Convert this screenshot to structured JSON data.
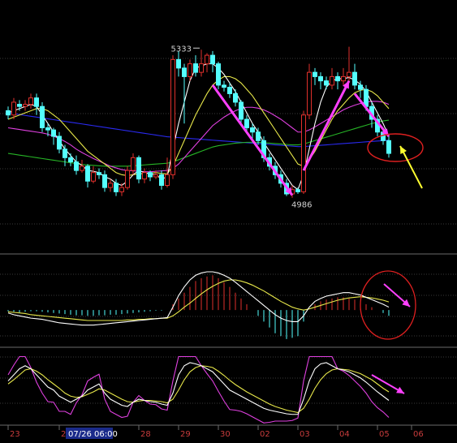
{
  "chart_data": {
    "type": "candlestick",
    "colors": {
      "background": "#000000",
      "up": "#e0302c",
      "down": "#54ffff",
      "ma_white": "#ffffff",
      "ma_yellow": "#e8e84a",
      "ma_magenta": "#e040e0",
      "ma_green": "#26b426",
      "ma_blue": "#2a2af0",
      "arrow_magenta": "#ff40ff",
      "arrow_yellow": "#ffff30",
      "circle": "#e02020",
      "grid": "#3a3a3a"
    },
    "price": {
      "ylim": [
        4860,
        5440
      ],
      "candles": [
        [
          5190,
          5180,
          5200,
          5170
        ],
        [
          5180,
          5210,
          5220,
          5170
        ],
        [
          5205,
          5200,
          5215,
          5190
        ],
        [
          5200,
          5205,
          5215,
          5190
        ],
        [
          5205,
          5220,
          5230,
          5195
        ],
        [
          5220,
          5200,
          5230,
          5180
        ],
        [
          5200,
          5150,
          5210,
          5140
        ],
        [
          5150,
          5145,
          5160,
          5130
        ],
        [
          5145,
          5130,
          5150,
          5110
        ],
        [
          5130,
          5100,
          5140,
          5090
        ],
        [
          5100,
          5080,
          5110,
          5060
        ],
        [
          5080,
          5070,
          5090,
          5060
        ],
        [
          5070,
          5050,
          5085,
          5040
        ],
        [
          5050,
          5060,
          5075,
          5045
        ],
        [
          5060,
          5025,
          5065,
          5010
        ],
        [
          5025,
          5045,
          5060,
          5020
        ],
        [
          5045,
          5040,
          5055,
          5030
        ],
        [
          5040,
          5010,
          5050,
          5000
        ],
        [
          5010,
          5020,
          5030,
          5000
        ],
        [
          5020,
          5000,
          5030,
          4990
        ],
        [
          5000,
          5010,
          5020,
          4990
        ],
        [
          5010,
          5050,
          5060,
          5005
        ],
        [
          5050,
          5080,
          5090,
          5040
        ],
        [
          5080,
          5030,
          5085,
          5020
        ],
        [
          5030,
          5045,
          5055,
          5020
        ],
        [
          5045,
          5035,
          5050,
          5025
        ],
        [
          5035,
          5040,
          5050,
          5030
        ],
        [
          5040,
          5015,
          5050,
          5005
        ],
        [
          5015,
          5040,
          5080,
          5010
        ],
        [
          5040,
          5310,
          5320,
          5030
        ],
        [
          5310,
          5290,
          5330,
          5270
        ],
        [
          5290,
          5270,
          5300,
          5160
        ],
        [
          5270,
          5300,
          5310,
          5260
        ],
        [
          5300,
          5280,
          5320,
          5270
        ],
        [
          5280,
          5300,
          5333,
          5270
        ],
        [
          5300,
          5320,
          5325,
          5280
        ],
        [
          5320,
          5300,
          5330,
          5280
        ],
        [
          5300,
          5250,
          5305,
          5240
        ],
        [
          5250,
          5245,
          5260,
          5235
        ],
        [
          5245,
          5230,
          5255,
          5220
        ],
        [
          5230,
          5210,
          5240,
          5200
        ],
        [
          5210,
          5170,
          5215,
          5160
        ],
        [
          5170,
          5150,
          5180,
          5140
        ],
        [
          5150,
          5140,
          5160,
          5125
        ],
        [
          5140,
          5120,
          5150,
          5110
        ],
        [
          5120,
          5080,
          5130,
          5070
        ],
        [
          5080,
          5060,
          5090,
          5050
        ],
        [
          5060,
          5040,
          5070,
          5030
        ],
        [
          5040,
          5020,
          5050,
          5010
        ],
        [
          5020,
          4995,
          5030,
          4990
        ],
        [
          4995,
          5005,
          5015,
          4986
        ],
        [
          5005,
          5000,
          5010,
          4995
        ],
        [
          5000,
          5180,
          5190,
          4995
        ],
        [
          5180,
          5280,
          5300,
          5170
        ],
        [
          5280,
          5270,
          5290,
          5250
        ],
        [
          5270,
          5260,
          5280,
          5240
        ],
        [
          5260,
          5250,
          5270,
          5240
        ],
        [
          5250,
          5270,
          5290,
          5240
        ],
        [
          5270,
          5260,
          5280,
          5240
        ],
        [
          5260,
          5270,
          5290,
          5250
        ],
        [
          5270,
          5280,
          5340,
          5260
        ],
        [
          5280,
          5250,
          5300,
          5240
        ],
        [
          5250,
          5240,
          5260,
          5220
        ],
        [
          5240,
          5200,
          5250,
          5190
        ],
        [
          5200,
          5170,
          5210,
          5150
        ],
        [
          5170,
          5140,
          5180,
          5130
        ],
        [
          5140,
          5120,
          5150,
          5110
        ],
        [
          5120,
          5090,
          5130,
          5080
        ]
      ],
      "ma_white": [
        5185,
        5190,
        5195,
        5200,
        5205,
        5200,
        5180,
        5160,
        5140,
        5120,
        5100,
        5085,
        5070,
        5062,
        5050,
        5048,
        5045,
        5035,
        5030,
        5020,
        5015,
        5025,
        5040,
        5050,
        5045,
        5042,
        5040,
        5030,
        5035,
        5100,
        5160,
        5210,
        5260,
        5290,
        5295,
        5300,
        5300,
        5290,
        5275,
        5255,
        5235,
        5210,
        5185,
        5160,
        5140,
        5115,
        5095,
        5075,
        5055,
        5035,
        5015,
        5005,
        5040,
        5100,
        5160,
        5210,
        5245,
        5260,
        5265,
        5265,
        5268,
        5262,
        5252,
        5235,
        5210,
        5185,
        5160,
        5130
      ],
      "ma_yellow": [
        5170,
        5175,
        5180,
        5185,
        5190,
        5195,
        5195,
        5190,
        5180,
        5170,
        5155,
        5140,
        5125,
        5110,
        5095,
        5085,
        5075,
        5065,
        5055,
        5045,
        5040,
        5038,
        5040,
        5042,
        5043,
        5044,
        5045,
        5043,
        5042,
        5060,
        5090,
        5120,
        5150,
        5180,
        5205,
        5230,
        5250,
        5262,
        5270,
        5270,
        5265,
        5255,
        5240,
        5225,
        5205,
        5185,
        5165,
        5145,
        5125,
        5105,
        5085,
        5065,
        5060,
        5075,
        5095,
        5120,
        5145,
        5170,
        5190,
        5205,
        5220,
        5232,
        5238,
        5240,
        5235,
        5225,
        5210,
        5195
      ],
      "ma_magenta": [
        5150,
        5148,
        5146,
        5144,
        5142,
        5140,
        5138,
        5135,
        5130,
        5125,
        5118,
        5110,
        5100,
        5092,
        5085,
        5078,
        5072,
        5066,
        5060,
        5056,
        5052,
        5050,
        5049,
        5048,
        5047,
        5047,
        5048,
        5049,
        5050,
        5055,
        5065,
        5080,
        5095,
        5110,
        5125,
        5140,
        5155,
        5165,
        5175,
        5183,
        5190,
        5195,
        5198,
        5198,
        5196,
        5192,
        5186,
        5178,
        5170,
        5160,
        5150,
        5140,
        5140,
        5145,
        5152,
        5160,
        5168,
        5176,
        5184,
        5192,
        5198,
        5203,
        5207,
        5210,
        5212,
        5212,
        5210,
        5205
      ],
      "ma_green": [
        5090,
        5088,
        5086,
        5084,
        5082,
        5080,
        5078,
        5076,
        5074,
        5072,
        5070,
        5068,
        5066,
        5064,
        5063,
        5062,
        5061,
        5060,
        5060,
        5060,
        5060,
        5060,
        5061,
        5062,
        5063,
        5064,
        5065,
        5066,
        5067,
        5070,
        5075,
        5080,
        5085,
        5090,
        5095,
        5100,
        5105,
        5108,
        5110,
        5112,
        5114,
        5115,
        5116,
        5116,
        5116,
        5115,
        5114,
        5113,
        5112,
        5111,
        5110,
        5110,
        5112,
        5116,
        5120,
        5124,
        5128,
        5132,
        5136,
        5140,
        5144,
        5148,
        5152,
        5156,
        5160,
        5163,
        5166,
        5168
      ],
      "ma_blue": [
        5185,
        5183,
        5181,
        5179,
        5177,
        5175,
        5173,
        5171,
        5169,
        5167,
        5165,
        5163,
        5161,
        5159,
        5157,
        5155,
        5153,
        5151,
        5149,
        5147,
        5145,
        5143,
        5141,
        5139,
        5137,
        5135,
        5133,
        5131,
        5129,
        5128,
        5127,
        5126,
        5125,
        5124,
        5123,
        5122,
        5121,
        5120,
        5119,
        5118,
        5117,
        5116,
        5115,
        5114,
        5113,
        5112,
        5111,
        5110,
        5109,
        5108,
        5107,
        5106,
        5106,
        5107,
        5108,
        5109,
        5110,
        5111,
        5112,
        5113,
        5114,
        5115,
        5116,
        5117,
        5118,
        5119,
        5120,
        5121
      ],
      "annotations": [
        {
          "text": "5333",
          "value": 5333,
          "index": 34
        },
        {
          "text": "4986",
          "value": 4986,
          "index": 49
        }
      ]
    },
    "macd": {
      "ylim": [
        -60,
        80
      ],
      "histogram": [
        -2,
        -3,
        -4,
        -3,
        -2,
        -2,
        -3,
        -4,
        -5,
        -6,
        -7,
        -8,
        -9,
        -9,
        -10,
        -10,
        -9,
        -9,
        -8,
        -8,
        -7,
        -6,
        -5,
        -4,
        -3,
        -2,
        -1,
        -1,
        0,
        10,
        20,
        30,
        40,
        50,
        55,
        58,
        60,
        55,
        48,
        40,
        30,
        20,
        10,
        0,
        -10,
        -20,
        -30,
        -40,
        -45,
        -50,
        -48,
        -45,
        -20,
        0,
        10,
        15,
        18,
        20,
        22,
        22,
        20,
        18,
        15,
        10,
        5,
        0,
        -5,
        -10
      ],
      "dif": [
        -5,
        -8,
        -10,
        -12,
        -14,
        -15,
        -16,
        -18,
        -20,
        -22,
        -23,
        -24,
        -25,
        -26,
        -26,
        -26,
        -25,
        -24,
        -23,
        -22,
        -21,
        -20,
        -19,
        -18,
        -17,
        -16,
        -15,
        -14,
        -13,
        5,
        25,
        40,
        52,
        60,
        64,
        66,
        66,
        64,
        60,
        55,
        48,
        40,
        32,
        24,
        16,
        8,
        0,
        -8,
        -14,
        -18,
        -20,
        -20,
        -10,
        5,
        15,
        20,
        24,
        26,
        28,
        30,
        30,
        28,
        26,
        22,
        18,
        14,
        10,
        5
      ],
      "dea": [
        -3,
        -4,
        -5,
        -6,
        -8,
        -9,
        -10,
        -11,
        -12,
        -13,
        -14,
        -15,
        -16,
        -17,
        -18,
        -18,
        -18,
        -18,
        -18,
        -18,
        -18,
        -17,
        -17,
        -16,
        -16,
        -15,
        -15,
        -14,
        -14,
        -10,
        -3,
        5,
        12,
        20,
        28,
        35,
        41,
        46,
        50,
        52,
        52,
        50,
        47,
        43,
        38,
        33,
        27,
        21,
        15,
        10,
        5,
        2,
        0,
        2,
        5,
        8,
        11,
        14,
        17,
        19,
        21,
        22,
        23,
        22,
        21,
        19,
        17,
        14
      ]
    },
    "kdj": {
      "ylim": [
        -10,
        110
      ],
      "k": [
        60,
        70,
        80,
        85,
        80,
        70,
        60,
        50,
        45,
        35,
        30,
        25,
        30,
        35,
        45,
        50,
        55,
        40,
        30,
        25,
        20,
        18,
        25,
        30,
        28,
        26,
        25,
        22,
        20,
        40,
        70,
        85,
        90,
        88,
        85,
        80,
        75,
        65,
        55,
        45,
        40,
        35,
        30,
        25,
        20,
        15,
        12,
        10,
        8,
        6,
        5,
        5,
        30,
        60,
        80,
        88,
        90,
        85,
        80,
        78,
        75,
        70,
        65,
        58,
        50,
        42,
        35,
        28
      ],
      "d": [
        55,
        62,
        70,
        78,
        80,
        76,
        70,
        62,
        55,
        48,
        40,
        35,
        33,
        34,
        38,
        42,
        47,
        45,
        40,
        35,
        30,
        26,
        25,
        27,
        28,
        28,
        27,
        26,
        24,
        30,
        45,
        62,
        75,
        82,
        85,
        84,
        82,
        76,
        69,
        61,
        54,
        48,
        42,
        37,
        32,
        27,
        22,
        18,
        15,
        12,
        10,
        8,
        15,
        30,
        48,
        62,
        72,
        78,
        80,
        79,
        78,
        75,
        72,
        67,
        62,
        55,
        48,
        42
      ],
      "j": [
        70,
        86,
        100,
        100,
        82,
        58,
        40,
        26,
        25,
        10,
        10,
        5,
        24,
        37,
        60,
        66,
        71,
        30,
        10,
        5,
        0,
        2,
        25,
        36,
        28,
        22,
        21,
        14,
        12,
        60,
        100,
        100,
        100,
        100,
        85,
        72,
        60,
        43,
        27,
        13,
        12,
        10,
        6,
        1,
        -4,
        -9,
        -8,
        -6,
        -6,
        -6,
        -5,
        -1,
        60,
        100,
        100,
        100,
        100,
        100,
        80,
        76,
        69,
        60,
        51,
        40,
        26,
        16,
        9,
        0
      ]
    },
    "x_ticks": [
      {
        "label": "23",
        "index": 0
      },
      {
        "label": "20",
        "index": 9
      },
      {
        "label": "28",
        "index": 23
      },
      {
        "label": "29",
        "index": 30
      },
      {
        "label": "30",
        "index": 37
      },
      {
        "label": "02",
        "index": 44
      },
      {
        "label": "03",
        "index": 51
      },
      {
        "label": "04",
        "index": 58
      },
      {
        "label": "05",
        "index": 65
      },
      {
        "label": "06",
        "index": 71
      }
    ],
    "cursor_label": "07/26 06:00"
  }
}
